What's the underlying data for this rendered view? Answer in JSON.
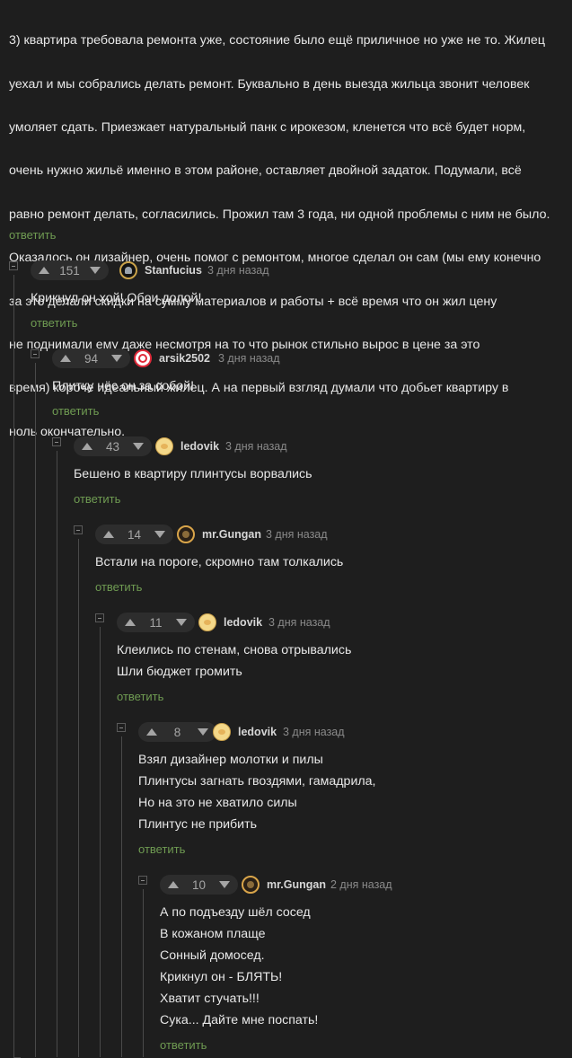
{
  "root_comment": {
    "lines": [
      "3) квартира требовала ремонта уже, состояние было ещё приличное но уже не то. Жилец",
      "уехал и мы собрались делать ремонт. Буквально в день выезда жильца звонит человек",
      "умоляет сдать. Приезжает натуральный панк с ирокезом, кленется что всё будет норм,",
      "очень нужно жильё именно в этом районе, оставляет двойной задаток. Подумали, всё",
      "равно ремонт делать, согласились. Прожил там 3 года, ни одной проблемы с ним не было.",
      "Оказалось он дизайнер, очень помог с ремонтом, многое сделал он сам (мы ему конечно",
      "за это делали скидки на сумму материалов и работы + всё время что он жил цену",
      "не поднимали ему даже несмотря на то что рынок стильно вырос в цене за это",
      "время) короче идеальный жилец. А на первый взгляд думали что добьет квартиру в",
      "ноль окончательно."
    ],
    "reply_label": "ответить"
  },
  "comments": [
    {
      "score": "151",
      "username": "Stanfucius",
      "time": "3 дня назад",
      "avatar": "stanfucius-avatar",
      "lines": [
        "Крикнул он хой! Обои долой!"
      ],
      "reply_label": "ответить"
    },
    {
      "score": "94",
      "username": "arsik2502",
      "time": "3 дня назад",
      "avatar": "arsik-avatar",
      "lines": [
        "Плитку нёс он за собой!"
      ],
      "reply_label": "ответить"
    },
    {
      "score": "43",
      "username": "ledovik",
      "time": "3 дня назад",
      "avatar": "ledovik-avatar",
      "lines": [
        "Бешено в квартиру плинтусы ворвались"
      ],
      "reply_label": "ответить"
    },
    {
      "score": "14",
      "username": "mr.Gungan",
      "time": "3 дня назад",
      "avatar": "gungan-avatar",
      "lines": [
        "Встали на пороге, скромно там толкались"
      ],
      "reply_label": "ответить"
    },
    {
      "score": "11",
      "username": "ledovik",
      "time": "3 дня назад",
      "avatar": "ledovik-avatar",
      "lines": [
        "Клеились по стенам, снова отрывались",
        "Шли бюджет громить"
      ],
      "reply_label": "ответить"
    },
    {
      "score": "8",
      "username": "ledovik",
      "time": "3 дня назад",
      "avatar": "ledovik-avatar",
      "lines": [
        "Взял дизайнер молотки и пилы",
        "Плинтусы загнать гвоздями, гамадрила,",
        "Но на это не хватило силы",
        "Плинтус не прибить"
      ],
      "reply_label": "ответить"
    },
    {
      "score": "10",
      "username": "mr.Gungan",
      "time": "2 дня назад",
      "avatar": "gungan-avatar",
      "lines": [
        "А по подъезду шёл сосед",
        "В кожаном плаще",
        "Сонный домосед.",
        "Крикнул он - БЛЯТЬ!",
        "Хватит стучать!!!",
        "Сука... Дайте мне поспать!"
      ],
      "reply_label": "ответить"
    }
  ]
}
